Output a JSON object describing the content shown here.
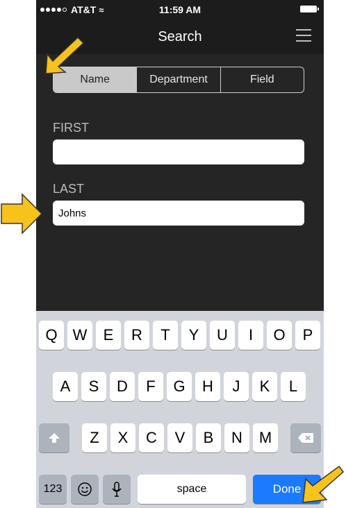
{
  "status": {
    "carrier": "AT&T",
    "time": "11:59 AM"
  },
  "nav": {
    "title": "Search"
  },
  "segments": [
    "Name",
    "Department",
    "Field"
  ],
  "form": {
    "first_label": "FIRST",
    "first_value": "",
    "last_label": "LAST",
    "last_value": "Johns"
  },
  "keyboard": {
    "row1": [
      "Q",
      "W",
      "E",
      "R",
      "T",
      "Y",
      "U",
      "I",
      "O",
      "P"
    ],
    "row2": [
      "A",
      "S",
      "D",
      "F",
      "G",
      "H",
      "J",
      "K",
      "L"
    ],
    "row3": [
      "Z",
      "X",
      "C",
      "V",
      "B",
      "N",
      "M"
    ],
    "num_label": "123",
    "space_label": "space",
    "done_label": "Done"
  },
  "colors": {
    "accent": "#1a7bff",
    "arrow": "#f7c21b",
    "background": "#252525"
  }
}
